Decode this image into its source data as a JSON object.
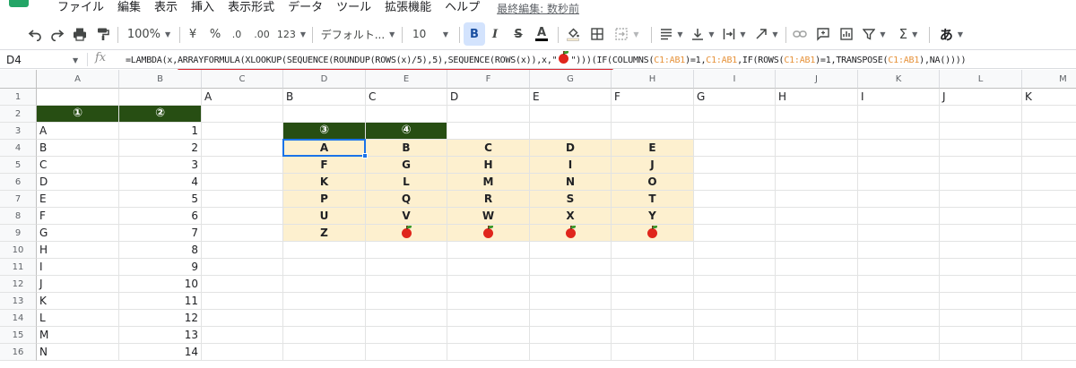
{
  "menu": {
    "items": [
      "ファイル",
      "編集",
      "表示",
      "挿入",
      "表示形式",
      "データ",
      "ツール",
      "拡張機能",
      "ヘルプ"
    ],
    "last_edit": "最終編集: 数秒前"
  },
  "toolbar": {
    "undo_icon": "undo-icon",
    "redo_icon": "redo-icon",
    "print_icon": "print-icon",
    "paint_format_icon": "paint-format-icon",
    "zoom": "100%",
    "currency": "¥",
    "percent": "%",
    "decrease_decimal": ".0",
    "increase_decimal": ".00",
    "more_formats": "123",
    "font_name": "デフォルト...",
    "font_size": "10",
    "bold": "B",
    "italic": "I",
    "strikethrough": "S",
    "text_color": "A",
    "input_tool": "あ"
  },
  "formula_bar": {
    "name_box": "D4",
    "fx": "fx",
    "segments": [
      {
        "t": "=LAMBDA(x,ARRAYFORMULA(XLOOKUP(SEQUENCE(ROUNDUP(ROWS(x)/5),5),SEQUENCE(ROWS(x)),x,\"",
        "ref": false
      },
      {
        "t": "🍎",
        "ref": false,
        "apple": true
      },
      {
        "t": "\")))(IF(COLUMNS(",
        "ref": false
      },
      {
        "t": "C1:AB1",
        "ref": true
      },
      {
        "t": ")=1,",
        "ref": false
      },
      {
        "t": "C1:AB1",
        "ref": true
      },
      {
        "t": ",IF(ROWS(",
        "ref": false
      },
      {
        "t": "C1:AB1",
        "ref": true
      },
      {
        "t": ")=1,TRANSPOSE(",
        "ref": false
      },
      {
        "t": "C1:AB1",
        "ref": true
      },
      {
        "t": "),NA())))",
        "ref": false
      }
    ]
  },
  "colors": {
    "header_fill": "#274e13",
    "output_fill": "#fdf0cf",
    "selection": "#1a73e8",
    "underline": "#d9232d"
  },
  "sheet": {
    "columns": [
      "A",
      "B",
      "C",
      "D",
      "E",
      "F",
      "G",
      "H",
      "I",
      "J",
      "K",
      "L",
      "M"
    ],
    "rows": [
      "1",
      "2",
      "3",
      "4",
      "5",
      "6",
      "7",
      "8",
      "9",
      "10",
      "11",
      "12",
      "13",
      "14",
      "15",
      "16"
    ],
    "row1_spill": [
      "A",
      "B",
      "C",
      "D",
      "E",
      "F",
      "G",
      "H",
      "I",
      "J",
      "K"
    ],
    "col_a_values": [
      "A",
      "B",
      "C",
      "D",
      "E",
      "F",
      "G",
      "H",
      "I",
      "J",
      "K",
      "L",
      "M",
      "N"
    ],
    "col_b_values": [
      "1",
      "2",
      "3",
      "4",
      "5",
      "6",
      "7",
      "8",
      "9",
      "10",
      "11",
      "12",
      "13",
      "14"
    ],
    "header_labels": [
      "①",
      "②",
      "③",
      "④"
    ],
    "selected_cell": "D4",
    "output_grid": [
      [
        "A",
        "B",
        "C",
        "D",
        "E"
      ],
      [
        "F",
        "G",
        "H",
        "I",
        "J"
      ],
      [
        "K",
        "L",
        "M",
        "N",
        "O"
      ],
      [
        "P",
        "Q",
        "R",
        "S",
        "T"
      ],
      [
        "U",
        "V",
        "W",
        "X",
        "Y"
      ],
      [
        "Z",
        "🍎",
        "🍎",
        "🍎",
        "🍎"
      ]
    ]
  }
}
